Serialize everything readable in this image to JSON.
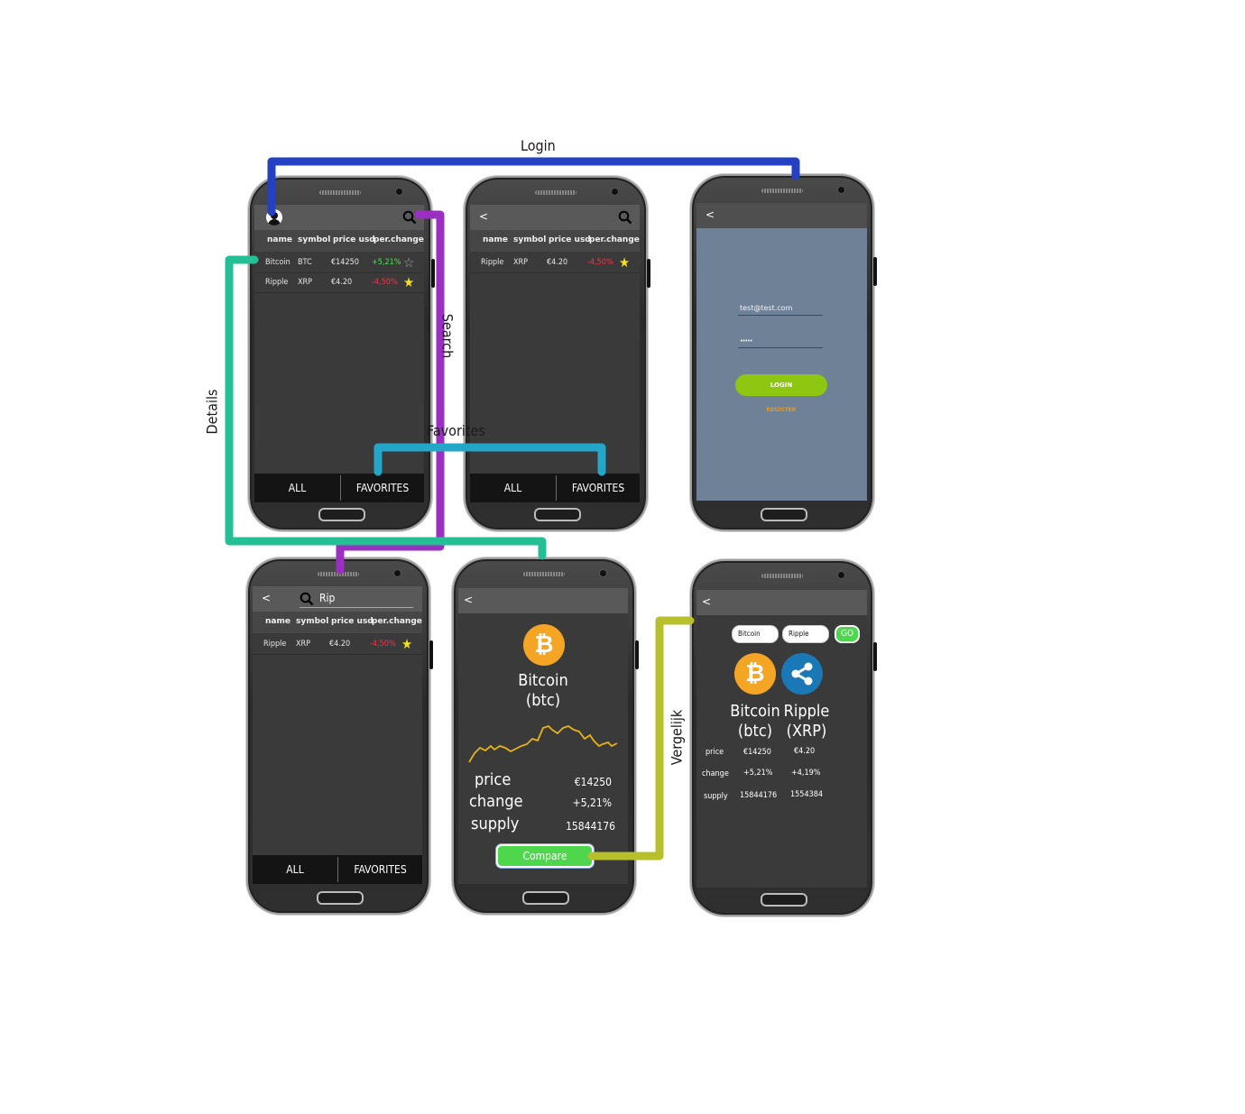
{
  "flows": {
    "login": "Login",
    "search": "Search",
    "details": "Details",
    "favorites": "Favorites",
    "compare": "Vergelijk"
  },
  "colors": {
    "login_line": "#2440c3",
    "search_line": "#9b2fc2",
    "details_line": "#24bf94",
    "favorites_line": "#23a6c8",
    "compare_line": "#b7bf2c"
  },
  "table_headers": [
    "name",
    "symbol",
    "price usd",
    "per.change"
  ],
  "tabs": {
    "all": "ALL",
    "favorites": "FAVORITES"
  },
  "coins": {
    "bitcoin": {
      "name": "Bitcoin",
      "symbol": "BTC",
      "price": "€14250",
      "change": "+5,21%",
      "favorite": false
    },
    "ripple": {
      "name": "Ripple",
      "symbol": "XRP",
      "price": "€4.20",
      "change": "-4,50%",
      "favorite": true
    }
  },
  "back_icon": "<",
  "login_screen": {
    "email": "test@test.com",
    "password": "•••••",
    "login_button": "LOGIN",
    "register_link": "REGISTER"
  },
  "search_screen": {
    "query": "Rip"
  },
  "detail_screen": {
    "name": "Bitcoin",
    "symbol": "(btc)",
    "labels": {
      "price": "price",
      "change": "change",
      "supply": "supply"
    },
    "price": "€14250",
    "change": "+5,21%",
    "supply": "15844176",
    "compare_button": "Compare"
  },
  "compare_screen": {
    "input1": "Bitcoin",
    "input2": "Ripple",
    "go_button": "GO",
    "coin1": {
      "name": "Bitcoin",
      "symbol": "(btc)",
      "price": "€14250",
      "change": "+5,21%",
      "supply": "15844176"
    },
    "coin2": {
      "name": "Ripple",
      "symbol": "(XRP)",
      "price": "€4.20",
      "change": "+4,19%",
      "supply": "1554384"
    },
    "row_labels": {
      "price": "price",
      "change": "change",
      "supply": "supply"
    }
  }
}
